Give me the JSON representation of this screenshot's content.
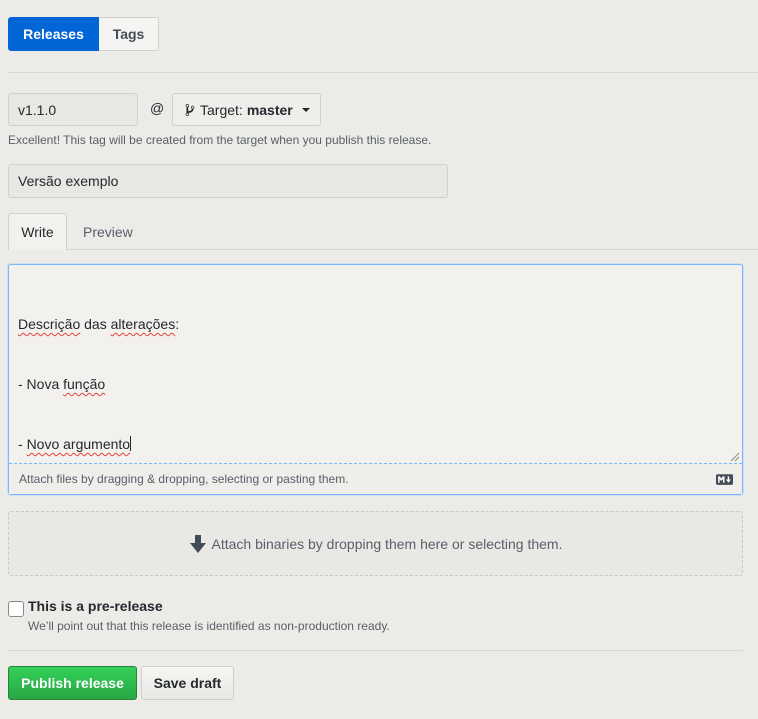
{
  "tabs": {
    "releases": "Releases",
    "tags": "Tags"
  },
  "tag": {
    "value": "v1.1.0",
    "at": "@",
    "target_label": "Target:",
    "target_value": "master",
    "hint": "Excellent! This tag will be created from the target when you publish this release."
  },
  "title_value": "Versão exemplo",
  "editor_tabs": {
    "write": "Write",
    "preview": "Preview"
  },
  "body": {
    "line1_a": "Descrição",
    "line1_b": " das ",
    "line1_c": "alterações",
    "line1_d": ":",
    "line2_a": "- Nova ",
    "line2_b": "função",
    "line3_a": "- ",
    "line3_b": "Novo argumento"
  },
  "attach_text": "Attach files by dragging & dropping, selecting or pasting them.",
  "dropzone_text": "Attach binaries by dropping them here or selecting them.",
  "prerelease": {
    "label": "This is a pre-release",
    "note": "We’ll point out that this release is identified as non-production ready.",
    "checked": false
  },
  "buttons": {
    "publish": "Publish release",
    "draft": "Save draft"
  },
  "icons": {
    "target": "git-branch-icon",
    "caret": "caret-down-icon",
    "markdown": "markdown-icon",
    "upload": "arrow-down-icon",
    "resize": "resize-handle-icon"
  },
  "colors": {
    "primary": "#0366d6",
    "success": "#28a745",
    "focus": "#79b8ff"
  }
}
